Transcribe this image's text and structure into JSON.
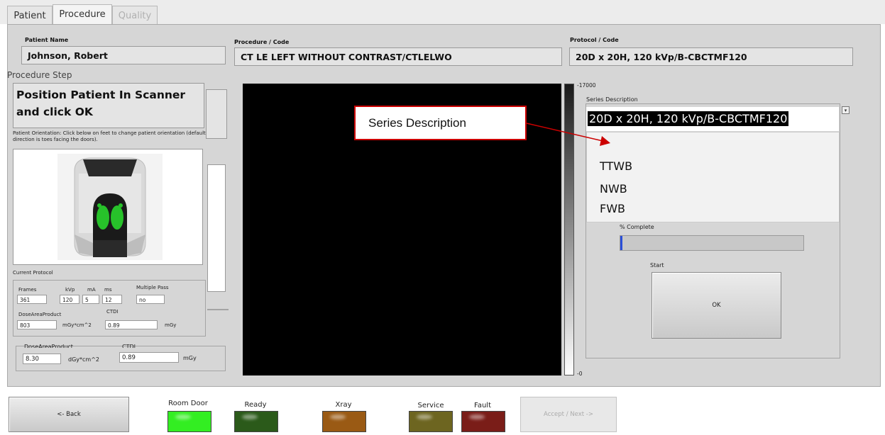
{
  "tabs": [
    {
      "label": "Patient"
    },
    {
      "label": "Procedure"
    },
    {
      "label": "Quality"
    }
  ],
  "header": {
    "patient_name_label": "Patient Name",
    "patient_name_value": "Johnson, Robert",
    "procedure_label": "Procedure / Code",
    "procedure_value": "CT LE LEFT WITHOUT CONTRAST/CTLELWO",
    "protocol_label": "Protocol / Code",
    "protocol_value": "20D x 20H, 120 kVp/B-CBCTMF120"
  },
  "procedure_step": {
    "label": "Procedure Step",
    "instruction": "Position Patient In Scanner and click OK",
    "orientation_note": "Patient Orientation: Click below on feet to change patient orientation (default direction is toes facing the doors)."
  },
  "current_protocol": {
    "label": "Current Protocol",
    "frames_label": "Frames",
    "frames_value": "361",
    "kvp_label": "kVp",
    "kvp_value": "120",
    "ma_label": "mA",
    "ma_value": "5",
    "ms_label": "ms",
    "ms_value": "12",
    "multipass_label": "Multiple Pass",
    "multipass_value": "no",
    "dap_label": "DoseAreaProduct",
    "dap_value": "803",
    "dap_unit": "mGy*cm^2",
    "ctdi_label": "CTDI",
    "ctdi_value": "0.89",
    "ctdi_unit": "mGy"
  },
  "dose_lower": {
    "dap_label": "DoseAreaProduct",
    "dap_value": "8.30",
    "dap_unit": "dGy*cm^2",
    "ctdi_label": "CTDI",
    "ctdi_value": "0.89",
    "ctdi_unit": "mGy"
  },
  "scale": {
    "top": "-17000",
    "bottom": "-0"
  },
  "series": {
    "label": "Series Description",
    "selected": "20D x 20H, 120 kVp/B-CBCTMF120",
    "options": [
      "TTWB",
      "NWB",
      "FWB"
    ]
  },
  "callout": {
    "text": "Series Description"
  },
  "progress": {
    "label": "% Complete",
    "fraction": 0.01
  },
  "start": {
    "label": "Start",
    "button": "OK"
  },
  "footer": {
    "back": "<- Back",
    "accept": "Accept / Next ->",
    "room_door": "Room Door",
    "ready": "Ready",
    "xray": "Xray",
    "service": "Service",
    "fault": "Fault"
  },
  "colors": {
    "room_door": "#33ee22",
    "ready": "#2b5a1a",
    "xray": "#9a5a14",
    "service": "#6d6520",
    "fault": "#7a1d18",
    "callout_border": "#cc0000"
  }
}
